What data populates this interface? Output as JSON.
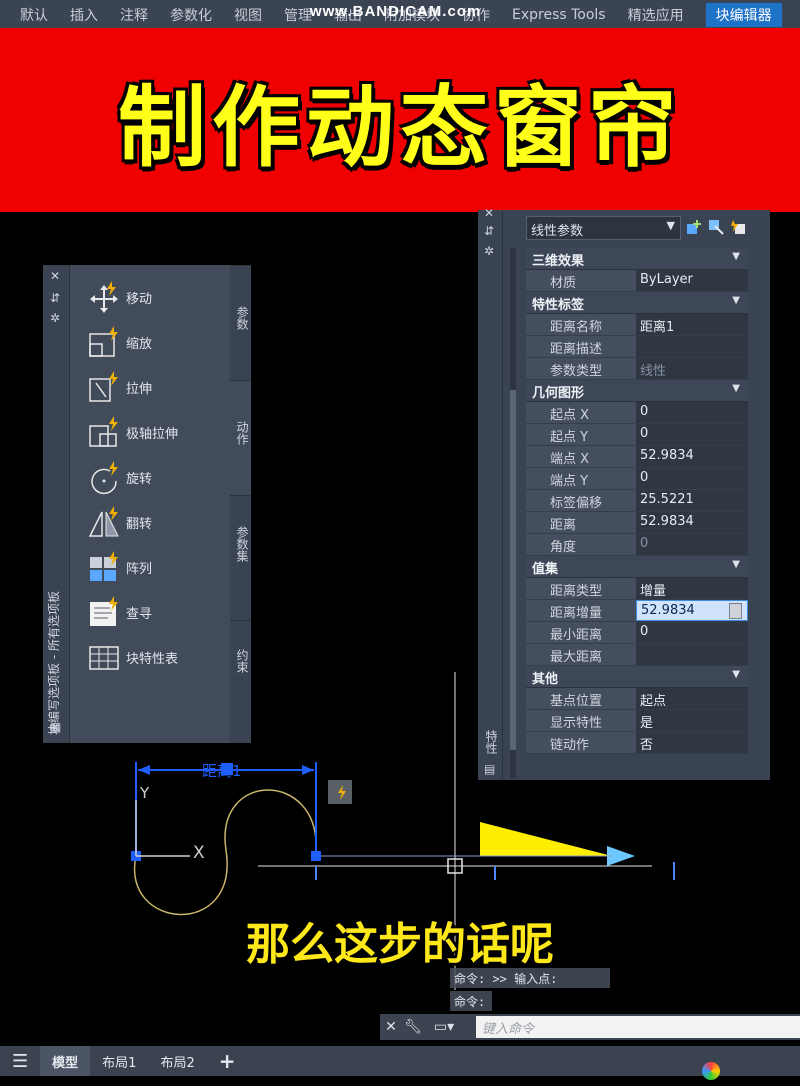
{
  "ribbon": {
    "tabs": [
      "默认",
      "插入",
      "注释",
      "参数化",
      "视图",
      "管理",
      "输出",
      "附加模块",
      "协作",
      "Express Tools",
      "精选应用",
      "块编辑器"
    ],
    "watermark": "www.BANDICAM.com"
  },
  "banner": {
    "title": "制作动态窗帘"
  },
  "palette": {
    "title": "块编写选项板 - 所有选项板",
    "tools": [
      {
        "label": "移动",
        "icon": "move-action-icon"
      },
      {
        "label": "缩放",
        "icon": "scale-action-icon"
      },
      {
        "label": "拉伸",
        "icon": "stretch-action-icon"
      },
      {
        "label": "极轴拉伸",
        "icon": "polar-stretch-action-icon"
      },
      {
        "label": "旋转",
        "icon": "rotate-action-icon"
      },
      {
        "label": "翻转",
        "icon": "flip-action-icon"
      },
      {
        "label": "阵列",
        "icon": "array-action-icon"
      },
      {
        "label": "查寻",
        "icon": "lookup-action-icon"
      },
      {
        "label": "块特性表",
        "icon": "block-table-icon"
      }
    ],
    "tabs": [
      "参数",
      "动作",
      "参数集",
      "约束"
    ],
    "active_tab": "动作"
  },
  "properties": {
    "vertical_title": "特性",
    "object_type": "线性参数",
    "sections": [
      {
        "title": "三维效果",
        "rows": [
          {
            "key": "材质",
            "value": "ByLayer"
          }
        ]
      },
      {
        "title": "特性标签",
        "rows": [
          {
            "key": "距离名称",
            "value": "距离1"
          },
          {
            "key": "距离描述",
            "value": ""
          },
          {
            "key": "参数类型",
            "value": "线性",
            "dim": true
          }
        ]
      },
      {
        "title": "几何图形",
        "rows": [
          {
            "key": "起点 X",
            "value": "0"
          },
          {
            "key": "起点 Y",
            "value": "0"
          },
          {
            "key": "端点 X",
            "value": "52.9834"
          },
          {
            "key": "端点 Y",
            "value": "0"
          },
          {
            "key": "标签偏移",
            "value": "25.5221"
          },
          {
            "key": "距离",
            "value": "52.9834"
          },
          {
            "key": "角度",
            "value": "0",
            "dim": true
          }
        ]
      },
      {
        "title": "值集",
        "rows": [
          {
            "key": "距离类型",
            "value": "增量"
          },
          {
            "key": "距离增量",
            "value": "52.9834",
            "selected": true
          },
          {
            "key": "最小距离",
            "value": "0"
          },
          {
            "key": "最大距离",
            "value": ""
          }
        ]
      },
      {
        "title": "其他",
        "rows": [
          {
            "key": "基点位置",
            "value": "起点"
          },
          {
            "key": "显示特性",
            "value": "是"
          },
          {
            "key": "链动作",
            "value": "否"
          }
        ]
      }
    ]
  },
  "drawing": {
    "dimension_label": "距离1",
    "ucs_y": "Y",
    "ucs_x": "X"
  },
  "subtitle": "那么这步的话呢",
  "command": {
    "history": [
      "命令: >> 输入点:",
      "命令:"
    ],
    "placeholder": "键入命令"
  },
  "status": {
    "tabs": [
      "模型",
      "布局1",
      "布局2"
    ],
    "active": "模型",
    "add": "+"
  },
  "colors": {
    "banner_bg": "#f00000",
    "banner_text": "#ffff1a",
    "subtitle_text": "#ffe81a",
    "dimension_blue": "#1f5fff",
    "arrow_yellow": "#ffee00",
    "arrow_cyan": "#6ec6ff"
  }
}
